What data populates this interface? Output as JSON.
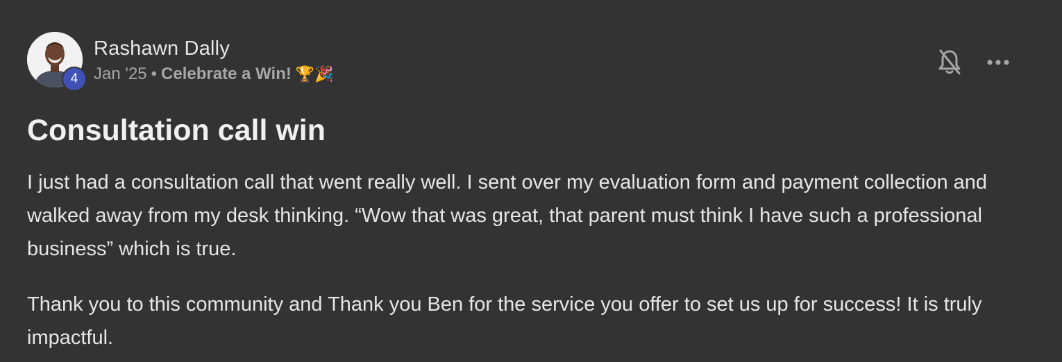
{
  "post": {
    "author": "Rashawn Dally",
    "level": "4",
    "date": "Jan '25",
    "separator": "•",
    "category": "Celebrate a Win!",
    "category_emoji": "🏆🎉",
    "title": "Consultation call win",
    "paragraphs": [
      "I just had a consultation call that went really well. I sent over my evaluation form and payment collection and walked away from my desk thinking. “Wow that was great, that parent must think I have such a professional business” which is true.",
      "Thank you to this community and Thank you Ben for the service you offer to set us up for success! It is truly impactful."
    ]
  },
  "actions": {
    "notifications_icon": "bell-off-icon",
    "more_icon": "more-horizontal-icon"
  },
  "colors": {
    "background": "#333333",
    "level_badge": "#3f51b5",
    "text": "#e6e6e6",
    "muted": "#a6a6a6"
  }
}
